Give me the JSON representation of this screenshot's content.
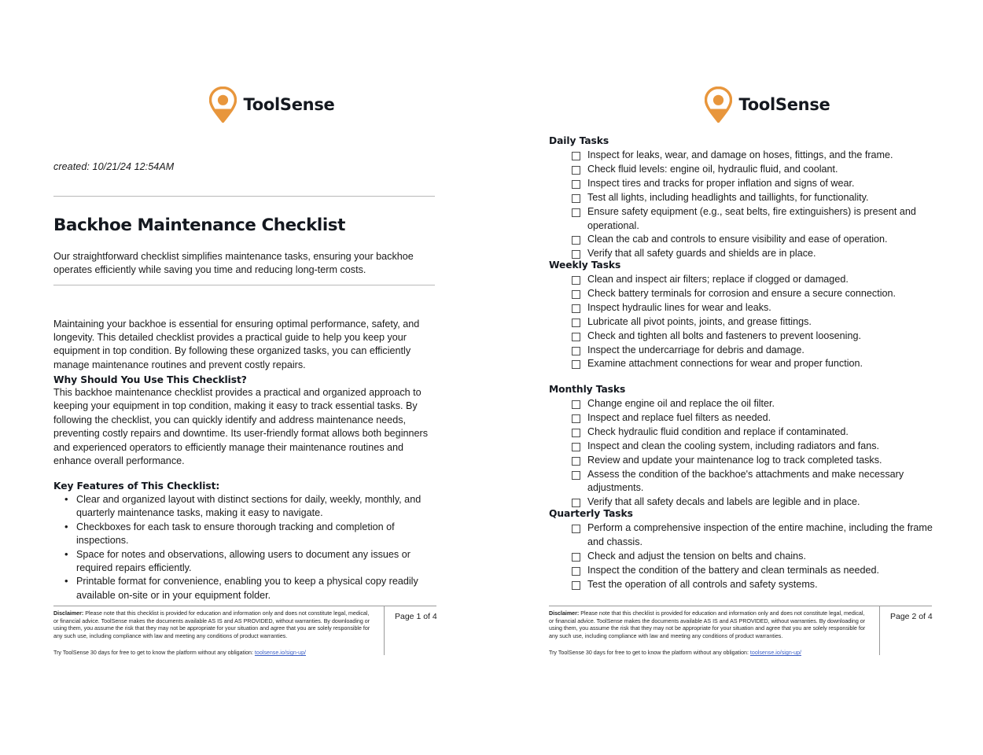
{
  "brand": {
    "name": "ToolSense",
    "logo_icon": "location-pin-icon",
    "accent_color": "#E8963C",
    "text_color": "#14181F"
  },
  "page1": {
    "created_label": "created: 10/21/24 12:54AM",
    "title": "Backhoe Maintenance Checklist",
    "subtitle": "Our straightforward checklist simplifies maintenance tasks, ensuring your backhoe operates efficiently while saving you time and reducing long-term costs.",
    "intro": "Maintaining your backhoe is essential for ensuring optimal performance, safety, and longevity. This detailed checklist provides a practical guide to help you keep your equipment in top condition. By following these organized tasks, you can efficiently manage maintenance routines and prevent costly repairs.",
    "why_heading": "Why Should You Use This Checklist?",
    "why_body": "This backhoe maintenance checklist provides a practical and organized approach to keeping your equipment in top condition, making it easy to track essential tasks. By following the checklist, you can quickly identify and address maintenance needs, preventing costly repairs and downtime. Its user-friendly format allows both beginners and experienced operators to efficiently manage their maintenance routines and enhance overall performance.",
    "features_heading": "Key Features of This Checklist:",
    "features": [
      "Clear and organized layout with distinct sections for daily, weekly, monthly, and quarterly maintenance tasks, making it easy to navigate.",
      "Checkboxes for each task to ensure thorough tracking and completion of inspections.",
      "Space for notes and observations, allowing users to document any issues or required repairs efficiently.",
      "Printable format for convenience, enabling you to keep a physical copy readily available on-site or in your equipment folder."
    ],
    "footer": {
      "disclaimer_label": "Disclaimer:",
      "disclaimer_text": " Please note that this checklist is provided for education and information only and does not constitute legal, medical, or financial advice. ToolSense makes the documents available AS IS and AS PROVIDED, without warranties. By downloading or using them, you assume the risk that they may not be appropriate for your situation and agree that you are solely responsible for any such use, including compliance with law and meeting any conditions of product warranties.",
      "try_text": "Try ToolSense 30 days for free to get to know the platform without any obligation: ",
      "link_text": "toolsense.io/sign-up/",
      "page_number": "Page 1 of 4"
    }
  },
  "page2": {
    "sections": [
      {
        "heading": "Daily Tasks",
        "tasks": [
          "Inspect for leaks, wear, and damage on hoses, fittings, and the frame.",
          "Check fluid levels: engine oil, hydraulic fluid, and coolant.",
          "Inspect tires and tracks for proper inflation and signs of wear.",
          "Test all lights, including headlights and taillights, for functionality.",
          "Ensure safety equipment (e.g., seat belts, fire extinguishers) is present and operational.",
          "Clean the cab and controls to ensure visibility and ease of operation.",
          "Verify that all safety guards and shields are in place."
        ]
      },
      {
        "heading": "Weekly Tasks",
        "tasks": [
          "Clean and inspect air filters; replace if clogged or damaged.",
          "Check battery terminals for corrosion and ensure a secure connection.",
          "Inspect hydraulic lines for wear and leaks.",
          "Lubricate all pivot points, joints, and grease fittings.",
          "Check and tighten all bolts and fasteners to prevent loosening.",
          "Inspect the undercarriage for debris and damage.",
          "Examine attachment connections for wear and proper function."
        ]
      },
      {
        "heading": "Monthly Tasks",
        "tasks": [
          "Change engine oil and replace the oil filter.",
          "Inspect and replace fuel filters as needed.",
          "Check hydraulic fluid condition and replace if contaminated.",
          "Inspect and clean the cooling system, including radiators and fans.",
          "Review and update your maintenance log to track completed tasks.",
          "Assess the condition of the backhoe's attachments and make necessary adjustments.",
          "Verify that all safety decals and labels are legible and in place."
        ]
      },
      {
        "heading": "Quarterly Tasks",
        "tasks": [
          "Perform a comprehensive inspection of the entire machine, including the frame and chassis.",
          "Check and adjust the tension on belts and chains.",
          "Inspect the condition of the battery and clean terminals as needed.",
          "Test the operation of all controls and safety systems."
        ]
      }
    ],
    "footer": {
      "disclaimer_label": "Disclaimer:",
      "disclaimer_text": " Please note that this checklist is provided for education and information only and does not constitute legal, medical, or financial advice. ToolSense makes the documents available AS IS and AS PROVIDED, without warranties. By downloading or using them, you assume the risk that they may not be appropriate for your situation and agree that you are solely responsible for any such use, including compliance with law and meeting any conditions of product warranties.",
      "try_text": "Try ToolSense 30 days for free to get to know the platform without any obligation: ",
      "link_text": "toolsense.io/sign-up/",
      "page_number": "Page 2 of 4"
    }
  }
}
